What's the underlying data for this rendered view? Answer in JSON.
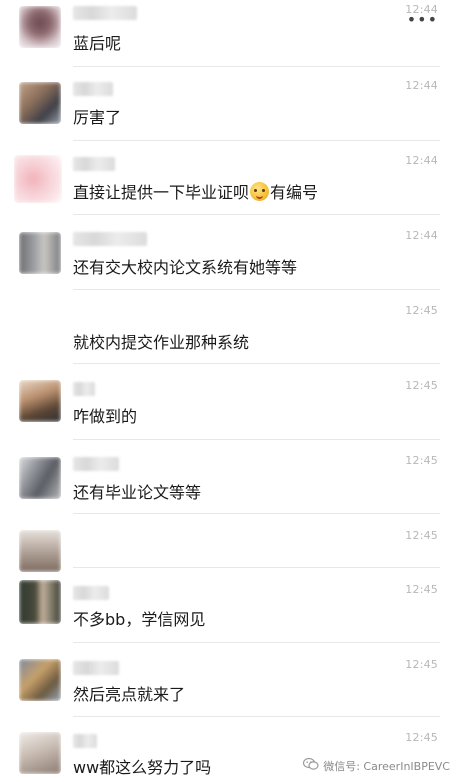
{
  "menu": {
    "icon": "more-dots-icon",
    "label": "•••"
  },
  "messages": [
    {
      "text": "蓝后呢",
      "time": "12:44"
    },
    {
      "text": "厉害了",
      "time": "12:44"
    },
    {
      "text_before": "直接让提供一下毕业证呗",
      "emoji": "grinning-emoji",
      "text_after": "有编号",
      "time": "12:44"
    },
    {
      "text": "还有交大校内论文系统有她等等",
      "time": "12:44"
    },
    {
      "text": "就校内提交作业那种系统",
      "time": "12:45"
    },
    {
      "text": "咋做到的",
      "time": "12:45"
    },
    {
      "text": "还有毕业论文等等",
      "time": "12:45"
    },
    {
      "text": "",
      "time": "12:45"
    },
    {
      "text": "不多bb，学信网见",
      "time": "12:45"
    },
    {
      "text": "然后亮点就来了",
      "time": "12:45"
    },
    {
      "text": "ww都这么努力了吗",
      "time": "12:45"
    }
  ],
  "watermark": {
    "icon": "wechat-channel-icon",
    "text": "微信号: CareerInIBPEVC"
  },
  "colors": {
    "background": "#ffffff",
    "text": "#1a1a1a",
    "time": "#b7b7b7",
    "divider": "#e8e8e8"
  }
}
